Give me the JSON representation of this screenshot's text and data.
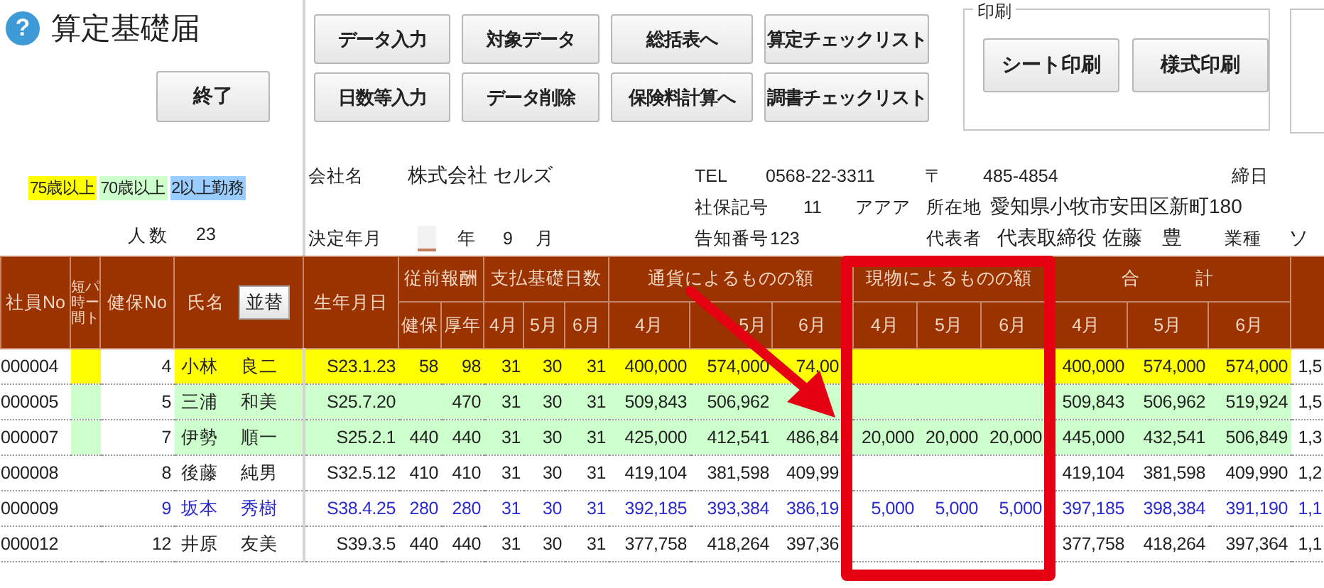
{
  "app": {
    "help_icon": "?",
    "title": "算定基礎届",
    "exit_button": "終了"
  },
  "toolbar": {
    "buttons": [
      "データ入力",
      "対象データ",
      "総括表へ",
      "算定チェックリスト",
      "日数等入力",
      "データ削除",
      "保険料計算へ",
      "調書チェックリスト"
    ]
  },
  "print_group": {
    "label": "印刷",
    "buttons": [
      "シート印刷",
      "様式印刷"
    ]
  },
  "legend": [
    {
      "label": "75歳以上",
      "color": "#ffff00"
    },
    {
      "label": "70歳以上",
      "color": "#ccffcc"
    },
    {
      "label": "2以上勤務",
      "color": "#99ccff"
    }
  ],
  "headcount": {
    "label": "人数",
    "value": "23"
  },
  "company": {
    "name_label": "会社名",
    "name": "株式会社 セルズ",
    "tel_label": "TEL",
    "tel": "0568-22-3311",
    "zip_label": "〒",
    "zip": "485-4854",
    "closing_label": "締日",
    "insurance_code_label": "社保記号",
    "insurance_code": "11",
    "insurance_kana": "アアア",
    "address_label": "所在地",
    "address": "愛知県小牧市安田区新町180",
    "decision_label": "決定年月",
    "year_unit": "年",
    "month": "9",
    "month_unit": "月",
    "notice_label": "告知番号",
    "notice": "123",
    "rep_label": "代表者",
    "rep": "代表取締役 佐藤　豊",
    "industry_label": "業種",
    "industry": "ソ"
  },
  "table": {
    "header": {
      "employee_no": "社員No",
      "short_time": "短時間",
      "part": "パート",
      "health_no": "健保No",
      "name": "氏名",
      "sort_button": "並替",
      "birth": "生年月日",
      "prev_pay": "従前報酬",
      "pay_days": "支払基礎日数",
      "cash": "通貨によるものの額",
      "in_kind": "現物によるものの額",
      "total": "合　　　計",
      "sub_cols": [
        "健保",
        "厚年",
        "4月",
        "5月",
        "6月",
        "4月",
        "5月",
        "6月",
        "4月",
        "5月",
        "6月",
        "4月",
        "5月",
        "6月"
      ]
    },
    "rows": [
      {
        "kind": "age75",
        "multi": false,
        "cells": [
          "000004",
          "4",
          "小林",
          "良二",
          "S23.1.23",
          "58",
          "98",
          "31",
          "30",
          "31",
          "400,000",
          "574,000",
          "74,00",
          null,
          null,
          null,
          "400,000",
          "574,000",
          "574,000",
          "1,5"
        ]
      },
      {
        "kind": "age70",
        "multi": false,
        "cells": [
          "000005",
          "5",
          "三浦",
          "和美",
          "S25.7.20",
          null,
          "470",
          "31",
          "30",
          "31",
          "509,843",
          "506,962",
          null,
          null,
          null,
          null,
          "509,843",
          "506,962",
          "519,924",
          "1,5"
        ]
      },
      {
        "kind": "age70",
        "multi": false,
        "cells": [
          "000007",
          "7",
          "伊勢",
          "順一",
          "S25.2.1",
          "440",
          "440",
          "31",
          "30",
          "31",
          "425,000",
          "412,541",
          "486,84",
          "20,000",
          "20,000",
          "20,000",
          "445,000",
          "432,541",
          "506,849",
          "1,3"
        ]
      },
      {
        "kind": "normal",
        "multi": false,
        "cells": [
          "000008",
          "8",
          "後藤",
          "純男",
          "S32.5.12",
          "410",
          "410",
          "31",
          "30",
          "31",
          "419,104",
          "381,598",
          "409,99",
          null,
          null,
          null,
          "419,104",
          "381,598",
          "409,990",
          "1,2"
        ]
      },
      {
        "kind": "normal",
        "multi": true,
        "cells": [
          "000009",
          "9",
          "坂本",
          "秀樹",
          "S38.4.25",
          "280",
          "280",
          "31",
          "30",
          "31",
          "392,185",
          "393,384",
          "386,19",
          "5,000",
          "5,000",
          "5,000",
          "397,185",
          "398,384",
          "391,190",
          "1,1"
        ]
      },
      {
        "kind": "normal",
        "multi": false,
        "cells": [
          "000012",
          "12",
          "井原",
          "友美",
          "S39.3.5",
          "440",
          "440",
          "31",
          "30",
          "31",
          "377,758",
          "418,264",
          "397,36",
          null,
          null,
          null,
          "377,758",
          "418,264",
          "397,364",
          "1,1"
        ]
      }
    ]
  }
}
